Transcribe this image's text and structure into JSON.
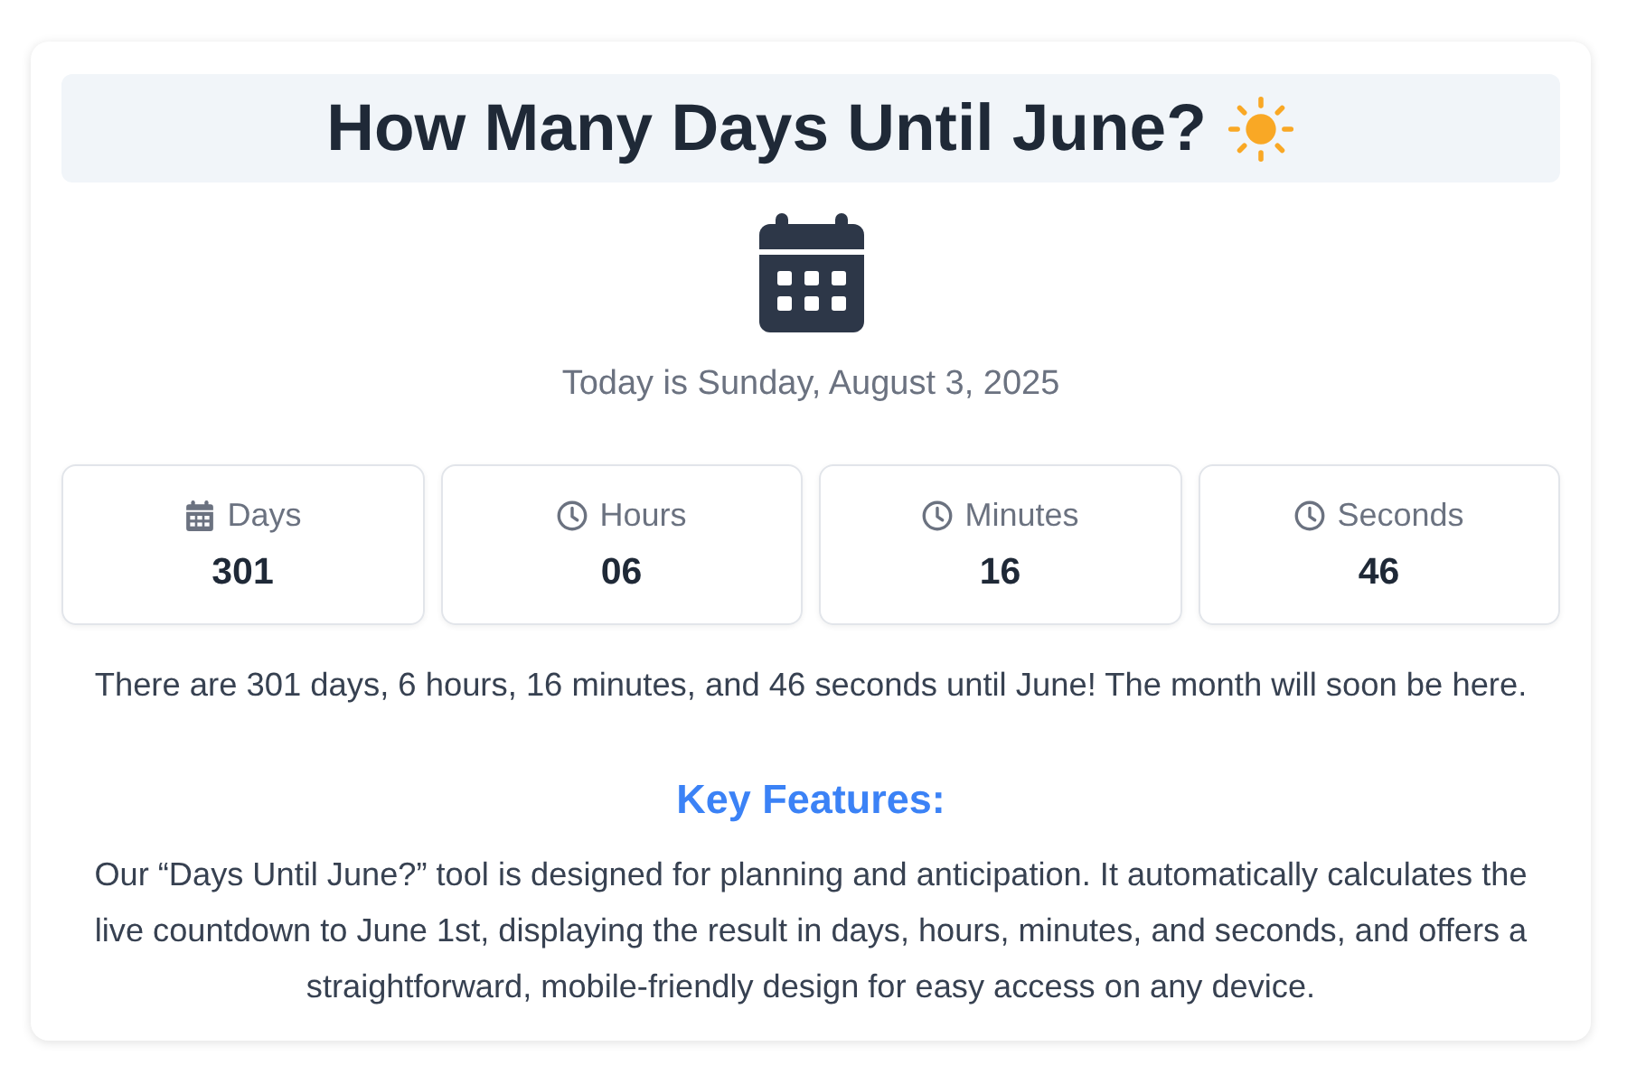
{
  "header": {
    "title": "How Many Days Until June?"
  },
  "today": "Today is Sunday, August 3, 2025",
  "stats": [
    {
      "kind": "calendar",
      "label": "Days",
      "value": "301"
    },
    {
      "kind": "clock",
      "label": "Hours",
      "value": "06"
    },
    {
      "kind": "clock",
      "label": "Minutes",
      "value": "16"
    },
    {
      "kind": "clock",
      "label": "Seconds",
      "value": "46"
    }
  ],
  "summary": "There are 301 days, 6 hours, 16 minutes, and 46 seconds until June! The month will soon be here.",
  "features": {
    "heading": "Key Features:",
    "text": "Our “Days Until June?” tool is designed for planning and anticipation. It automatically calculates the live countdown to June 1st, displaying the result in days, hours, minutes, and seconds, and offers a straightforward, mobile-friendly design for easy access on any device."
  }
}
